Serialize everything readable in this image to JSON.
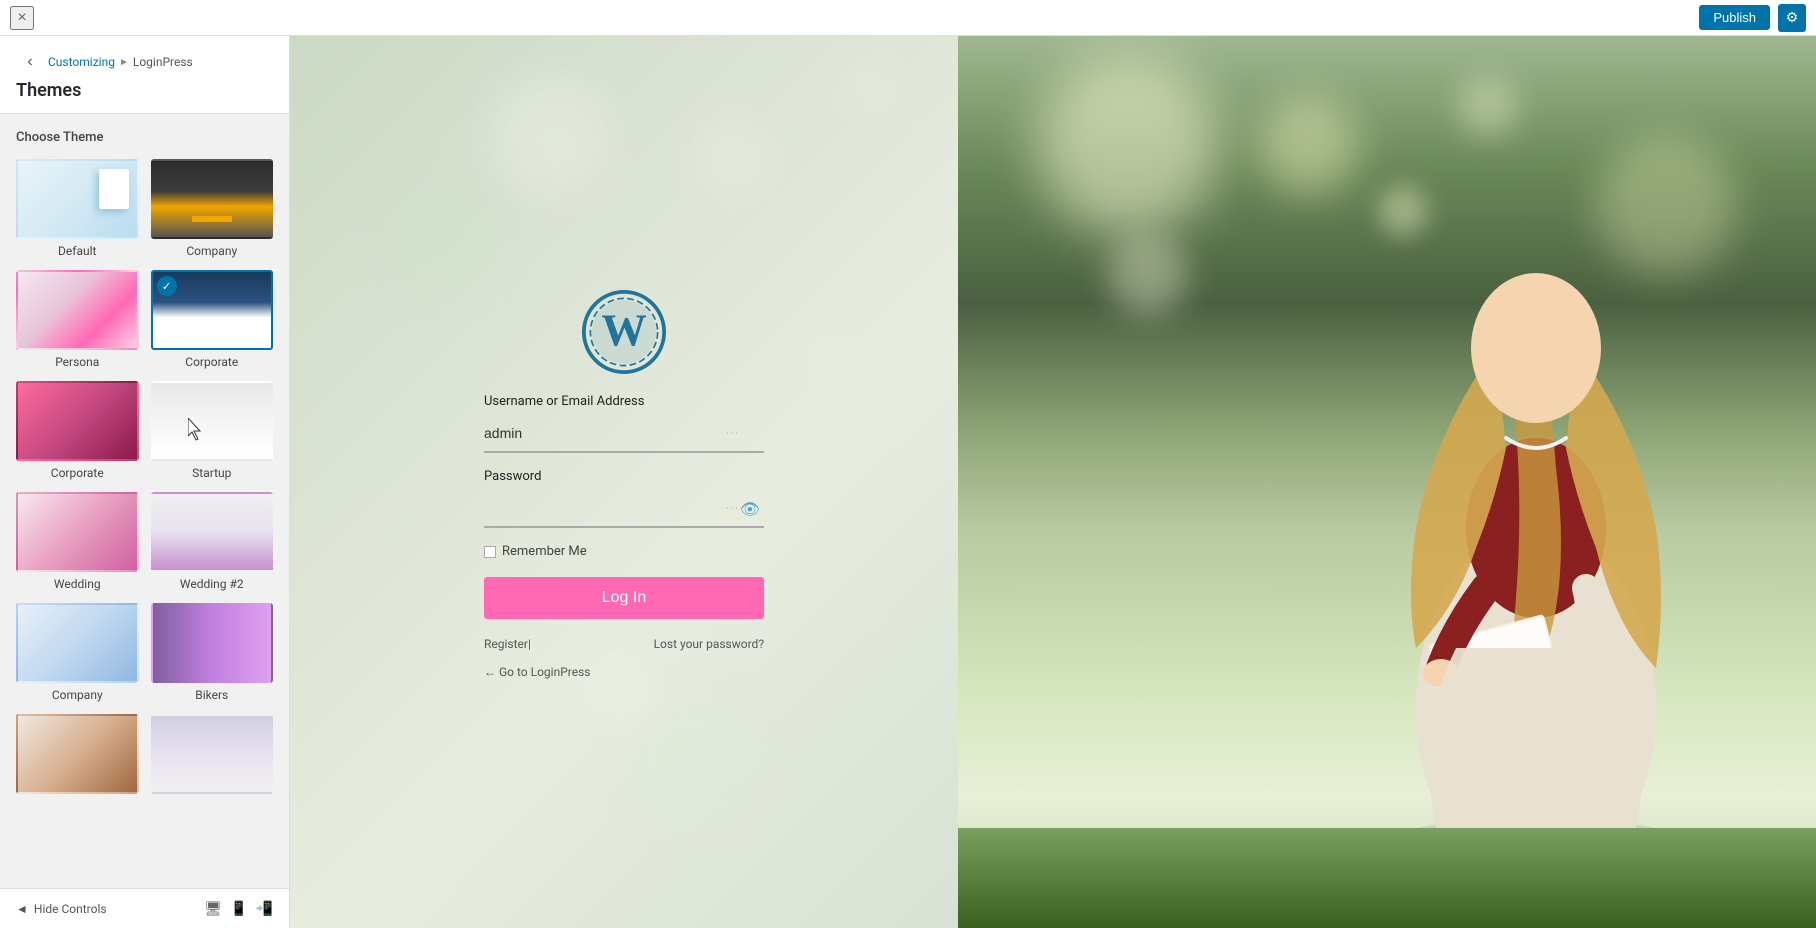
{
  "topbar": {
    "close_label": "×",
    "publish_label": "Publish",
    "gear_label": "⚙"
  },
  "sidebar": {
    "nav": {
      "customizing_label": "Customizing",
      "arrow": "►",
      "loginpress_label": "LoginPress"
    },
    "title": "Themes",
    "choose_label": "Choose Theme",
    "back_icon": "‹",
    "themes": [
      {
        "id": "default",
        "name": "Default",
        "thumb_class": "thumb-default",
        "selected": false
      },
      {
        "id": "company",
        "name": "Company",
        "thumb_class": "thumb-company",
        "selected": false
      },
      {
        "id": "persona",
        "name": "Persona",
        "thumb_class": "thumb-persona",
        "selected": false
      },
      {
        "id": "corporate-sel",
        "name": "Corporate",
        "thumb_class": "thumb-corporate-sel",
        "selected": true
      },
      {
        "id": "corporate2",
        "name": "Corporate",
        "thumb_class": "thumb-corporate2",
        "selected": false
      },
      {
        "id": "startup",
        "name": "Startup",
        "thumb_class": "thumb-startup",
        "selected": false
      },
      {
        "id": "wedding",
        "name": "Wedding",
        "thumb_class": "thumb-wedding",
        "selected": false
      },
      {
        "id": "wedding2",
        "name": "Wedding #2",
        "thumb_class": "thumb-wedding2",
        "selected": false
      },
      {
        "id": "company2",
        "name": "Company",
        "thumb_class": "thumb-company2",
        "selected": false
      },
      {
        "id": "bikers",
        "name": "Bikers",
        "thumb_class": "thumb-bikers",
        "selected": false
      },
      {
        "id": "extra1",
        "name": "",
        "thumb_class": "thumb-extra1",
        "selected": false
      },
      {
        "id": "extra2",
        "name": "",
        "thumb_class": "thumb-extra2",
        "selected": false
      }
    ],
    "bottom": {
      "hide_controls": "Hide Controls",
      "hide_icon": "◄"
    }
  },
  "login": {
    "username_label": "Username or Email Address",
    "username_value": "admin",
    "password_label": "Password",
    "remember_label": "Remember Me",
    "login_button": "Log In",
    "register_link": "Register|",
    "lost_password_link": "Lost your password?",
    "go_to_link": "← Go to LoginPress"
  }
}
